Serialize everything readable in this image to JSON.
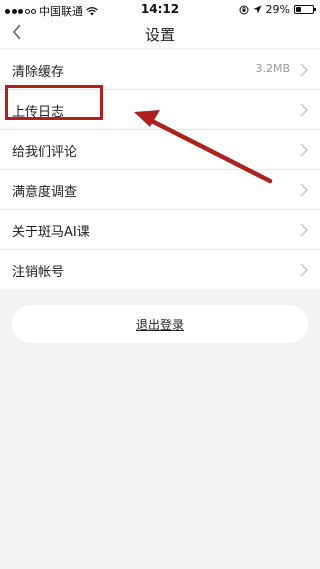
{
  "status_bar": {
    "carrier": "中国联通",
    "time": "14:12",
    "battery_text": "29%",
    "battery_level": 0.29,
    "icons": [
      "signal-icon",
      "wifi-icon",
      "rotation-lock-icon",
      "location-icon",
      "battery-icon"
    ]
  },
  "nav": {
    "title": "设置",
    "back_icon": "chevron-left-icon"
  },
  "settings": {
    "items": [
      {
        "label": "清除缓存",
        "value": "3.2MB"
      },
      {
        "label": "上传日志",
        "value": ""
      },
      {
        "label": "给我们评论",
        "value": ""
      },
      {
        "label": "满意度调查",
        "value": ""
      },
      {
        "label": "关于斑马AI课",
        "value": ""
      },
      {
        "label": "注销帐号",
        "value": ""
      }
    ]
  },
  "logout": {
    "label": "退出登录"
  },
  "annotation": {
    "color": "#b0201f"
  }
}
